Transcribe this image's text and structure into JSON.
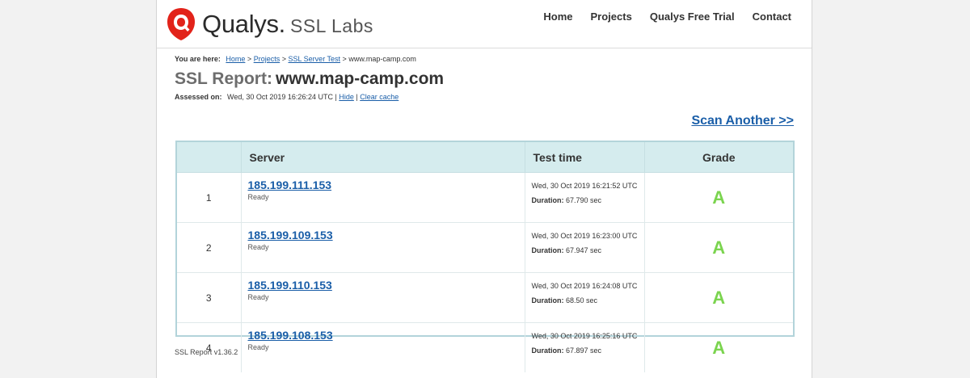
{
  "header": {
    "brand_name": "Qualys.",
    "brand_product": "SSL Labs",
    "nav": [
      "Home",
      "Projects",
      "Qualys Free Trial",
      "Contact"
    ]
  },
  "breadcrumb": {
    "prefix": "You are here:",
    "items": [
      "Home",
      "Projects",
      "SSL Server Test"
    ],
    "current": "www.map-camp.com",
    "separator": ">"
  },
  "report": {
    "title_label": "SSL Report:",
    "host": "www.map-camp.com",
    "assessed_label": "Assessed on:",
    "assessed_value": "Wed, 30 Oct 2019 16:26:24 UTC",
    "hide_label": "Hide",
    "clear_cache_label": "Clear cache",
    "scan_another": "Scan Another >>"
  },
  "table": {
    "headers": [
      "",
      "Server",
      "Test time",
      "Grade"
    ],
    "duration_label": "Duration:",
    "rows": [
      {
        "num": "1",
        "ip": "185.199.111.153",
        "status": "Ready",
        "time": "Wed, 30 Oct 2019 16:21:52 UTC",
        "duration": "67.790 sec",
        "grade": "A"
      },
      {
        "num": "2",
        "ip": "185.199.109.153",
        "status": "Ready",
        "time": "Wed, 30 Oct 2019 16:23:00 UTC",
        "duration": "67.947 sec",
        "grade": "A"
      },
      {
        "num": "3",
        "ip": "185.199.110.153",
        "status": "Ready",
        "time": "Wed, 30 Oct 2019 16:24:08 UTC",
        "duration": "68.50 sec",
        "grade": "A"
      },
      {
        "num": "4",
        "ip": "185.199.108.153",
        "status": "Ready",
        "time": "Wed, 30 Oct 2019 16:25:16 UTC",
        "duration": "67.897 sec",
        "grade": "A"
      }
    ]
  },
  "footer": {
    "version": "SSL Report v1.36.2"
  },
  "colors": {
    "brand_red": "#e2231a",
    "link_blue": "#1a5ea8",
    "grade_green": "#7bd44f",
    "header_teal": "#d5ecee"
  }
}
